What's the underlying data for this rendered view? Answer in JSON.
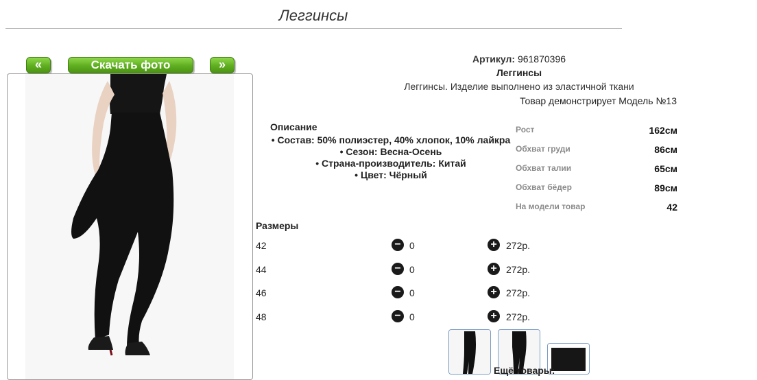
{
  "page": {
    "title": "Леггинсы"
  },
  "nav": {
    "prev_label": "«",
    "download_label": "Скачать фото",
    "next_label": "»"
  },
  "product": {
    "article_label": "Артикул:",
    "article_value": "961870396",
    "name": "Леггинсы",
    "description": "Леггинсы. Изделие выполнено из эластичной ткани",
    "model_note": "Товар демонстрирует Модель №13"
  },
  "description": {
    "heading": "Описание",
    "items": [
      "Состав: 50% полиэстер, 40% хлопок, 10% лайкра",
      "Сезон: Весна-Осень",
      "Страна-производитель: Китай",
      "Цвет: Чёрный"
    ]
  },
  "measurements": [
    {
      "label": "Рост",
      "value": "162см"
    },
    {
      "label": "Обхват груди",
      "value": "86см"
    },
    {
      "label": "Обхват талии",
      "value": "65см"
    },
    {
      "label": "Обхват бёдер",
      "value": "89см"
    },
    {
      "label": "На модели товар",
      "value": "42"
    }
  ],
  "sizes": {
    "heading": "Размеры",
    "rows": [
      {
        "size": "42",
        "qty": "0",
        "price": "272р."
      },
      {
        "size": "44",
        "qty": "0",
        "price": "272р."
      },
      {
        "size": "46",
        "qty": "0",
        "price": "272р."
      },
      {
        "size": "48",
        "qty": "0",
        "price": "272р."
      }
    ]
  },
  "more_goods_label": "Ещё товары:",
  "icons": {
    "minus": "minus-circle-icon",
    "plus": "plus-circle-icon"
  },
  "colors": {
    "accent_green": "#5fae20",
    "thumb_border": "#7a9cc4"
  }
}
